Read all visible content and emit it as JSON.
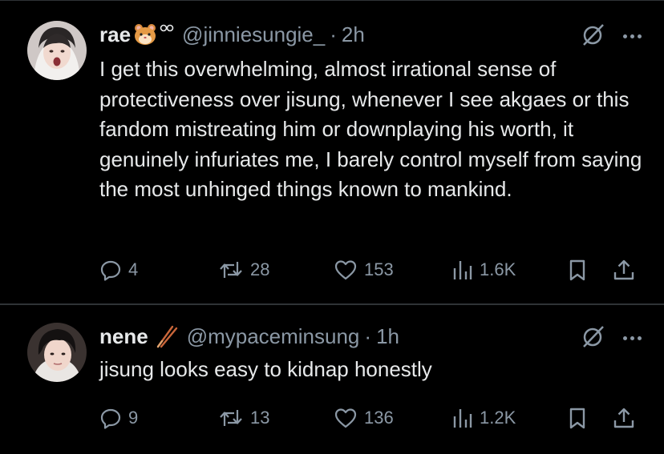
{
  "tweets": [
    {
      "name": "rae",
      "handle": "@jinniesungie_",
      "time": "2h",
      "text": "I get this overwhelming, almost irrational sense of protectiveness over jisung, whenever I see akgaes or this fandom mistreating him or downplaying his worth, it genuinely infuriates me, I barely control myself from saying the most unhinged things known to mankind.",
      "replies": "4",
      "retweets": "28",
      "likes": "153",
      "views": "1.6K"
    },
    {
      "name": "nene",
      "handle": "@mypaceminsung",
      "time": "1h",
      "text": "jisung looks easy to kidnap honestly",
      "replies": "9",
      "retweets": "13",
      "likes": "136",
      "views": "1.2K"
    }
  ],
  "separator": "·",
  "colors": {
    "background": "#000000",
    "text": "#e7e9ea",
    "secondary": "#8b98a5",
    "divider": "#2f3336"
  },
  "icons": [
    "grok-icon",
    "more-icon",
    "reply-icon",
    "retweet-icon",
    "like-icon",
    "views-icon",
    "bookmark-icon",
    "share-icon",
    "hamster-emoji",
    "chopsticks-emoji"
  ]
}
